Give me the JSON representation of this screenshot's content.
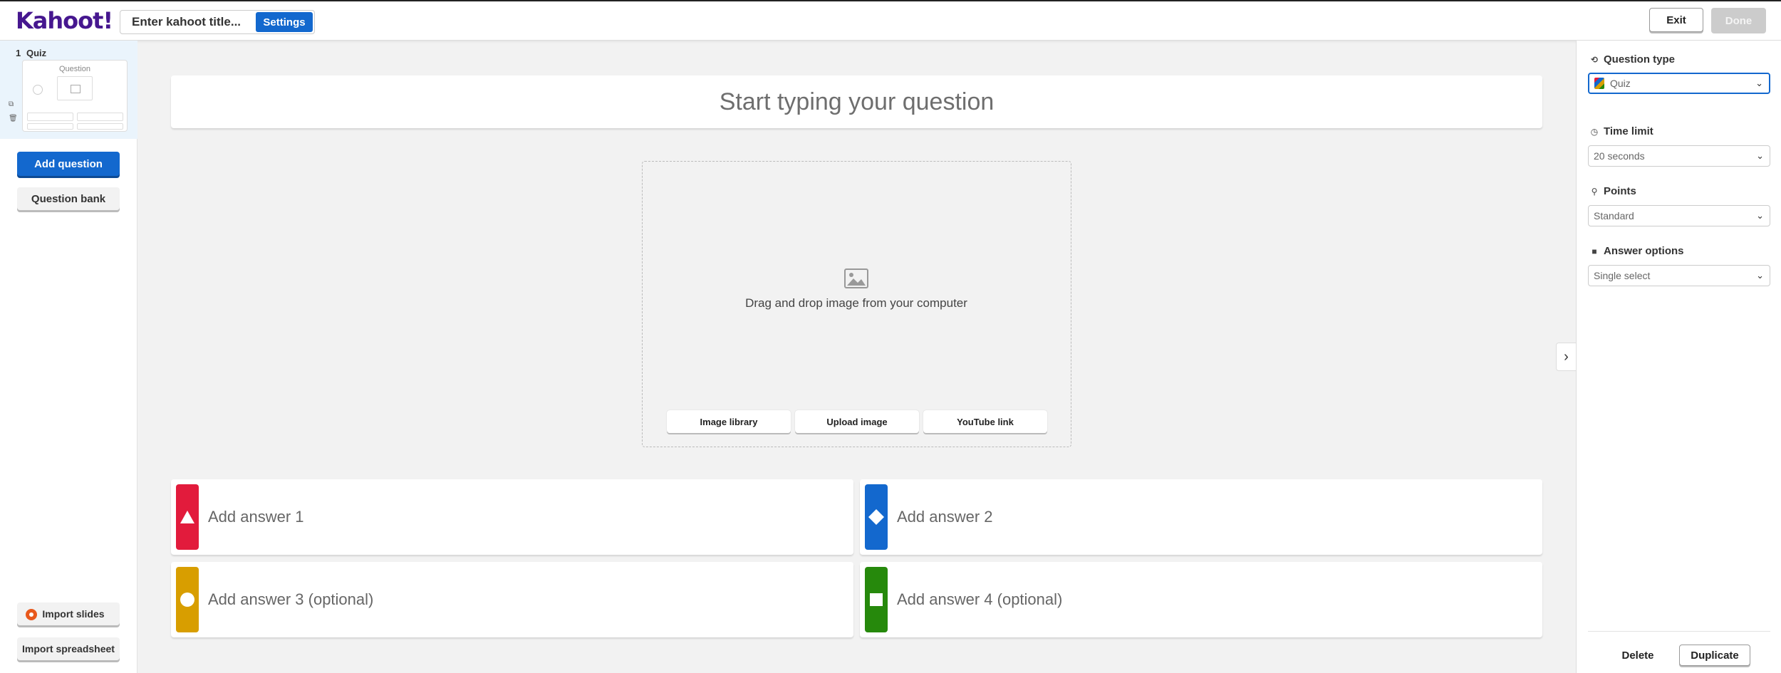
{
  "app": {
    "logo_text": "Kahoot!",
    "brand_color": "#46178f",
    "accent_color": "#1368ce"
  },
  "header": {
    "title_placeholder": "Enter kahoot title...",
    "settings_label": "Settings",
    "exit_label": "Exit",
    "done_label": "Done"
  },
  "sidebar": {
    "slides": [
      {
        "number": "1",
        "type": "Quiz",
        "thumb_question": "Question"
      }
    ],
    "add_question_label": "Add question",
    "question_bank_label": "Question bank",
    "import_slides_label": "Import slides",
    "import_spreadsheet_label": "Import spreadsheet"
  },
  "editor": {
    "question_placeholder": "Start typing your question",
    "media": {
      "drop_text": "Drag and drop image from your computer",
      "image_library_label": "Image library",
      "upload_image_label": "Upload image",
      "youtube_link_label": "YouTube link"
    },
    "answers": [
      {
        "placeholder": "Add answer 1",
        "color": "#e21b3c",
        "shape": "triangle-icon"
      },
      {
        "placeholder": "Add answer 2",
        "color": "#1368ce",
        "shape": "diamond-icon"
      },
      {
        "placeholder": "Add answer 3 (optional)",
        "color": "#d89e00",
        "shape": "circle-icon"
      },
      {
        "placeholder": "Add answer 4 (optional)",
        "color": "#26890c",
        "shape": "square-icon"
      }
    ]
  },
  "right_panel": {
    "question_type_label": "Question type",
    "question_type_value": "Quiz",
    "time_limit_label": "Time limit",
    "time_limit_value": "20 seconds",
    "points_label": "Points",
    "points_value": "Standard",
    "answer_options_label": "Answer options",
    "answer_options_value": "Single select",
    "delete_label": "Delete",
    "duplicate_label": "Duplicate"
  }
}
